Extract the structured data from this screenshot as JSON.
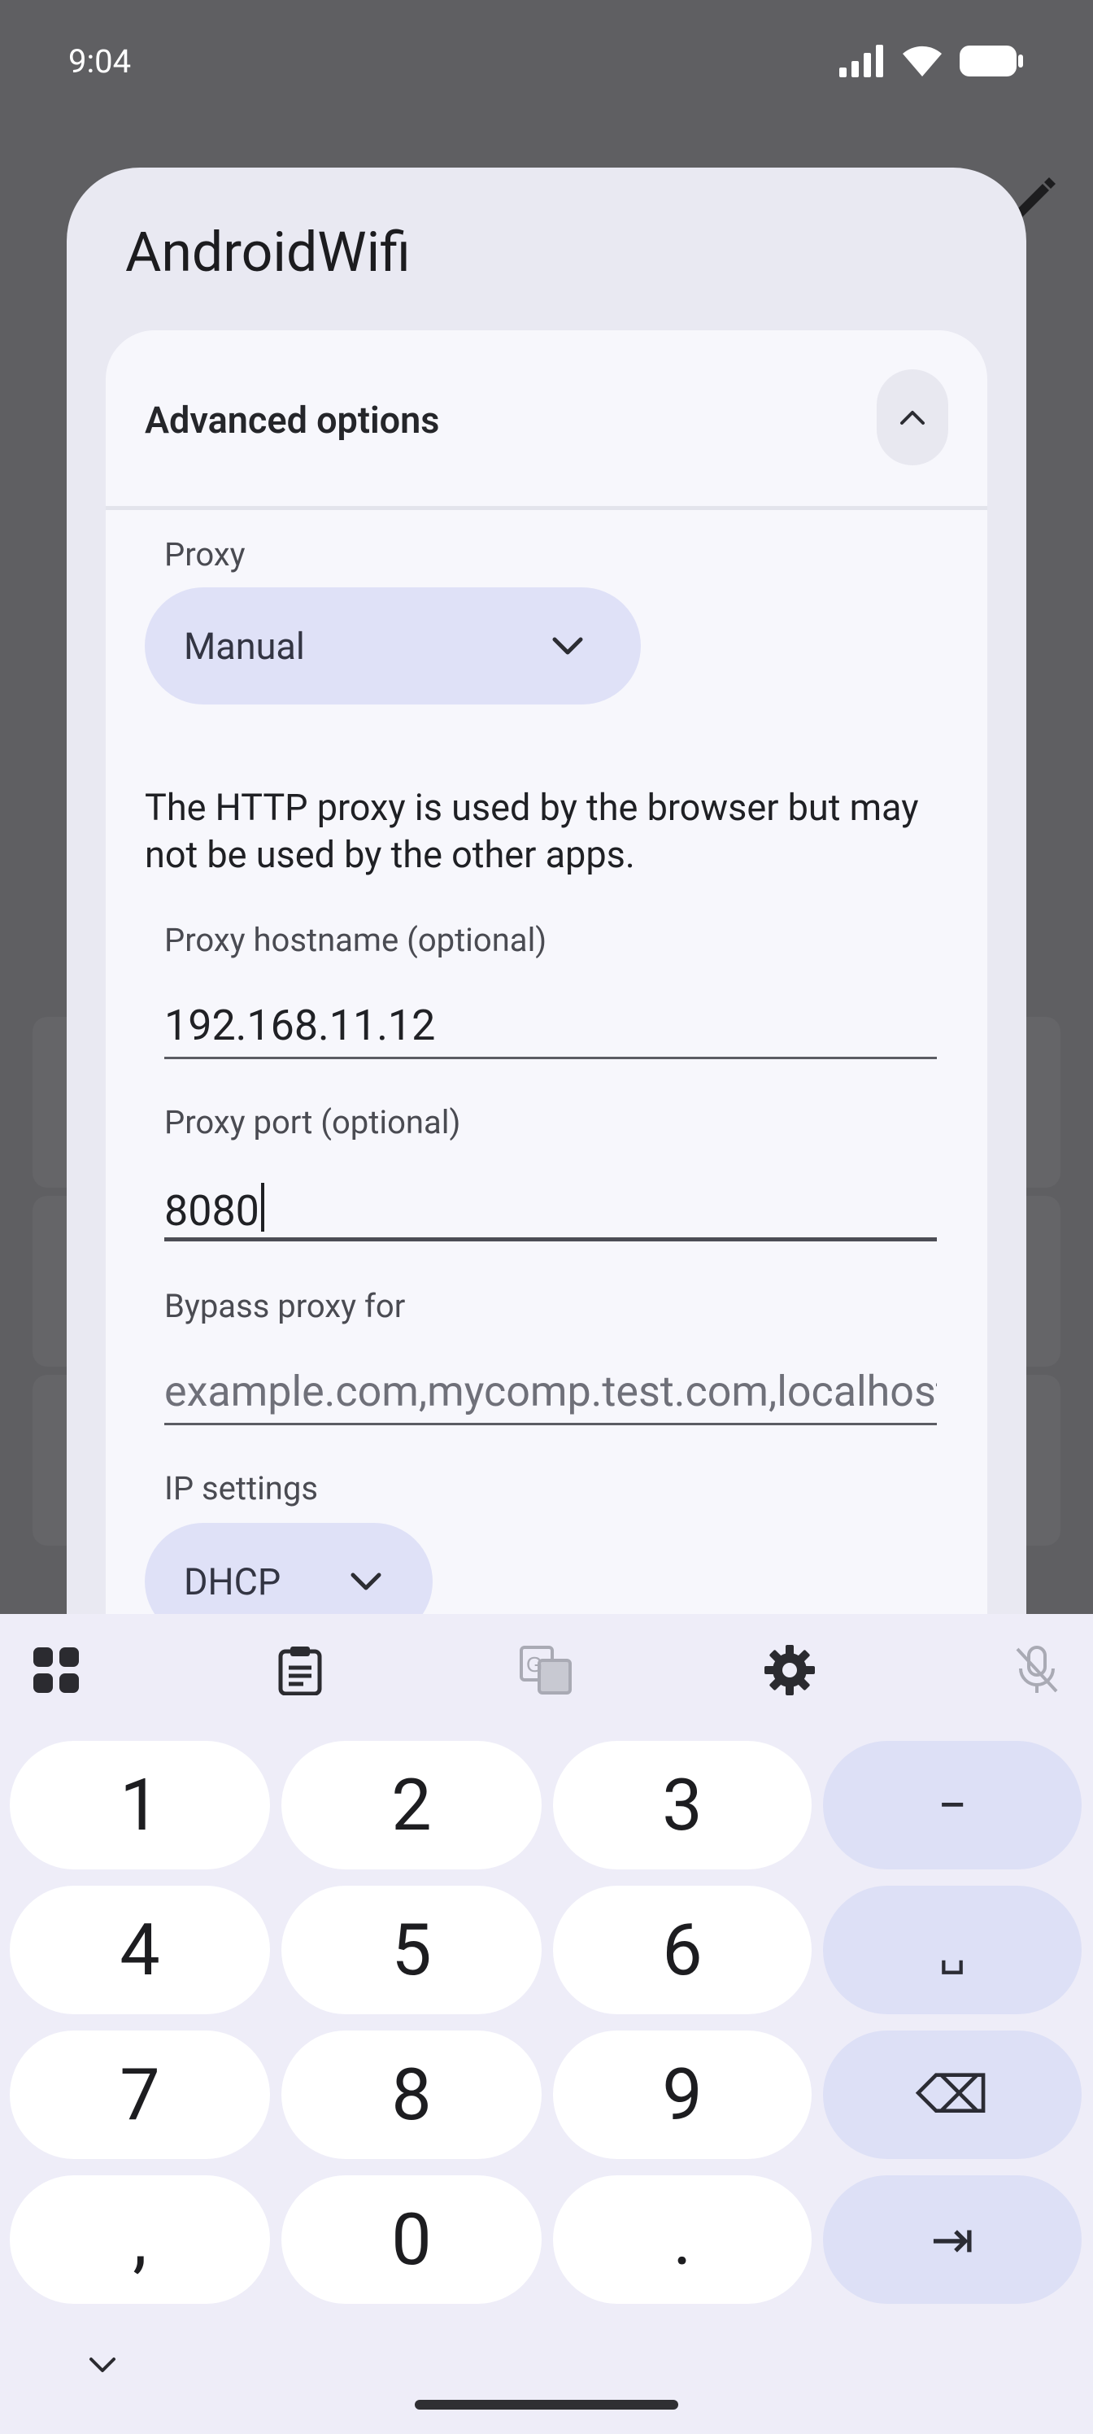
{
  "status_bar": {
    "time": "9:04"
  },
  "dialog": {
    "title": "AndroidWifi",
    "section_title": "Advanced options",
    "proxy": {
      "label": "Proxy",
      "selected": "Manual",
      "description": "The HTTP proxy is used by the browser but may not be used by the other apps."
    },
    "hostname": {
      "label": "Proxy hostname (optional)",
      "value": "192.168.11.12"
    },
    "port": {
      "label": "Proxy port (optional)",
      "value": "8080"
    },
    "bypass": {
      "label": "Bypass proxy for",
      "placeholder": "example.com,mycomp.test.com,localhost"
    },
    "ip_settings": {
      "label": "IP settings",
      "selected": "DHCP"
    }
  },
  "keyboard": {
    "toolbar_icons": [
      "apps-grid-icon",
      "clipboard-icon",
      "translate-icon",
      "settings-gear-icon",
      "mic-off-icon"
    ],
    "keys": [
      "1",
      "2",
      "3",
      "−",
      "4",
      "5",
      "6",
      "␣",
      "7",
      "8",
      "9",
      "⌫",
      ",",
      "0",
      ".",
      "⇥"
    ]
  },
  "colors": {
    "scrim": "#5f5f62",
    "dialog_bg": "#e9e9f2",
    "panel_bg": "#f7f7fc",
    "dropdown_bg": "#dfe1f7",
    "keyboard_bg": "#eeedf8",
    "key_fn_bg": "#dde0f6"
  }
}
